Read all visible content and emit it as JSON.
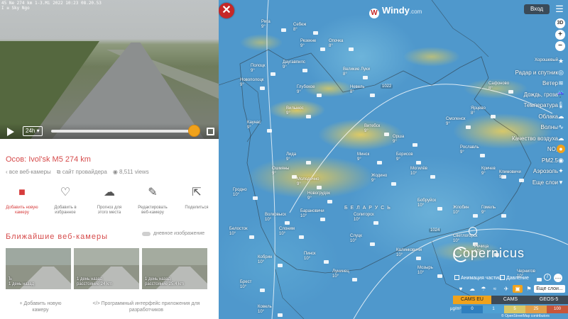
{
  "video": {
    "osd_line1": "45 Ne 274 km 1-3.Mi 2022 10:23 08.20.53",
    "osd_line2": "I ≡ Sky Ngo",
    "speed_label": "24h"
  },
  "camera": {
    "title": "Осов: Ivol'sk M5 274 km",
    "all_cams": "все веб-камеры",
    "provider": "сайт провайдера",
    "views": "8,511 views"
  },
  "actions": [
    {
      "icon": "camera-icon",
      "label1": "Добавить новую",
      "label2": "камеру"
    },
    {
      "icon": "heart-icon",
      "label1": "Добавить в",
      "label2": "избранное"
    },
    {
      "icon": "weather-icon",
      "label1": "Прогноз для",
      "label2": "этого места"
    },
    {
      "icon": "pencil-icon",
      "label1": "Редактировать",
      "label2": "веб-камеру"
    },
    {
      "icon": "share-icon",
      "label1": "Поделиться",
      "label2": ""
    }
  ],
  "nearby": {
    "title": "Ближайшие веб-камеры",
    "toggle_label": "дневное изображение",
    "thumbs": [
      {
        "line1": "Ъ",
        "line2": "1 день назад"
      },
      {
        "line1": "1 день назад",
        "line2": "расстояние 24 km"
      },
      {
        "line1": "1 день назад",
        "line2": "расстояние 25.4 km"
      }
    ]
  },
  "bottom_links": {
    "add_camera_1": "+ Добавить новую",
    "add_camera_2": "камеру",
    "api_1": "</> Программный интерфейс приложения для",
    "api_2": "разработчиков"
  },
  "map": {
    "logo": "Windy",
    "logo_sub": ".com",
    "login": "Вход",
    "menu": [
      "Хорошевый",
      "Радар и спутник",
      "Ветер",
      "Дождь, гроза",
      "Температура",
      "Облака",
      "Волны",
      "Качество воздуха",
      "NO₂",
      "PM2.5",
      "Аэрозоль",
      "Еще слои"
    ],
    "checks": [
      "Анимация частиц",
      "Давление"
    ],
    "more_layers": "Еще слои...",
    "models": [
      "CAMS EU",
      "CAMS",
      "GEOS-5"
    ],
    "scale_unit": "µg/m³",
    "scale_values": [
      "0",
      "1",
      "5",
      "25",
      "100"
    ],
    "scale_colors": [
      "#2f7fbf",
      "#4fa0d3",
      "#d8c868",
      "#e2a04a",
      "#c7563a"
    ],
    "copyright": "© OpenStreetMap contributors",
    "copernicus": "Copernicus",
    "pressure_labels": [
      "1022",
      "1024"
    ],
    "country": "Б Е Л А Р У С Ь",
    "cities": [
      [
        "Рига",
        "9°"
      ],
      [
        "Резекне",
        "9°"
      ],
      [
        "Даугавпилс",
        "9°"
      ],
      [
        "Гомель",
        "9°"
      ],
      [
        "Вильнюс",
        "9°"
      ],
      [
        "Каунас",
        "9°"
      ],
      [
        "Минск",
        "9°"
      ],
      [
        "Брест",
        "10°"
      ],
      [
        "Пинск",
        "10°"
      ],
      [
        "Гродно",
        "10°"
      ],
      [
        "Витебск",
        "9°"
      ],
      [
        "Полоцк",
        "9°"
      ],
      [
        "Новополоцк",
        "9°"
      ],
      [
        "Орша",
        "9°"
      ],
      [
        "Могилёв",
        "10°"
      ],
      [
        "Бобруйск",
        "10°"
      ],
      [
        "Лида",
        "9°"
      ],
      [
        "Барановичи",
        "10°"
      ],
      [
        "Солигорск",
        "10°"
      ],
      [
        "Светлогорск",
        "10°"
      ],
      [
        "Мозырь",
        "10°"
      ],
      [
        "Жлобин",
        "10°"
      ],
      [
        "Речица",
        "10°"
      ],
      [
        "Борисов",
        "9°"
      ],
      [
        "Жодино",
        "9°"
      ],
      [
        "Молодечно",
        "9°"
      ],
      [
        "Слуцк",
        "10°"
      ],
      [
        "Кобрин",
        "10°"
      ],
      [
        "Ковель",
        "10°"
      ],
      [
        "Лунинец",
        "10°"
      ],
      [
        "Калинковичи",
        "10°"
      ],
      [
        "Смоленск",
        "9°"
      ],
      [
        "Рославль",
        "9°"
      ],
      [
        "Кричев",
        "9°"
      ],
      [
        "Чернигов",
        "10°"
      ],
      [
        "Климовичи",
        "9°"
      ],
      [
        "Себеж",
        "8°"
      ],
      [
        "Опочка",
        "8°"
      ],
      [
        "Великие Луки",
        "8°"
      ],
      [
        "Невель",
        "8°"
      ],
      [
        "Сафоново",
        "8°"
      ],
      [
        "Ярцево",
        "8°"
      ],
      [
        "Глубокое",
        "9°"
      ],
      [
        "Ошмяны",
        "9°"
      ],
      [
        "Волковыск",
        "10°"
      ],
      [
        "Слоним",
        "10°"
      ],
      [
        "Новогрудок",
        "9°"
      ],
      [
        "Белосток",
        "10°"
      ]
    ]
  }
}
